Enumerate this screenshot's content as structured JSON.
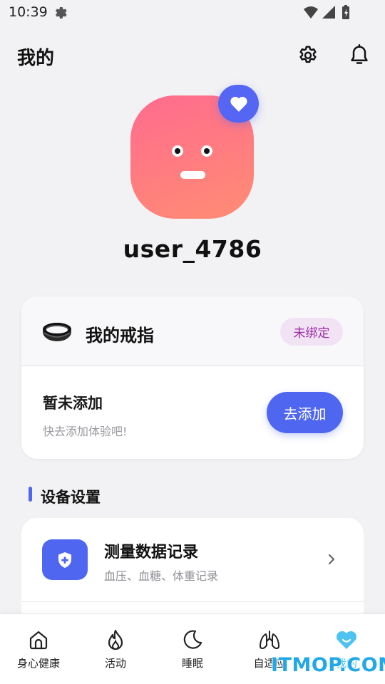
{
  "status_bar": {
    "time": "10:39"
  },
  "header": {
    "title": "我的"
  },
  "profile": {
    "username": "user_4786"
  },
  "ring_card": {
    "title": "我的戒指",
    "bind_status": "未绑定",
    "empty_title": "暂未添加",
    "empty_subtitle": "快去添加体验吧!",
    "add_button": "去添加"
  },
  "device_settings": {
    "section_title": "设备设置",
    "items": [
      {
        "title": "测量数据记录",
        "subtitle": "血压、血糖、体重记录",
        "icon": "shield-plus-icon"
      }
    ]
  },
  "bottom_nav": {
    "items": [
      {
        "label": "身心健康",
        "icon": "home-icon",
        "active": false
      },
      {
        "label": "活动",
        "icon": "flame-icon",
        "active": false
      },
      {
        "label": "睡眠",
        "icon": "moon-icon",
        "active": false
      },
      {
        "label": "自适应",
        "icon": "lungs-icon",
        "active": false
      },
      {
        "label": "我的",
        "icon": "heart-smile-icon",
        "active": true
      }
    ]
  },
  "watermark": "ITMOP.COM",
  "colors": {
    "accent": "#4f67f0",
    "active_nav": "#4ec3ef",
    "badge_text": "#9a2ca6",
    "avatar_start": "#ff6b8e",
    "avatar_end": "#ff8c73"
  }
}
